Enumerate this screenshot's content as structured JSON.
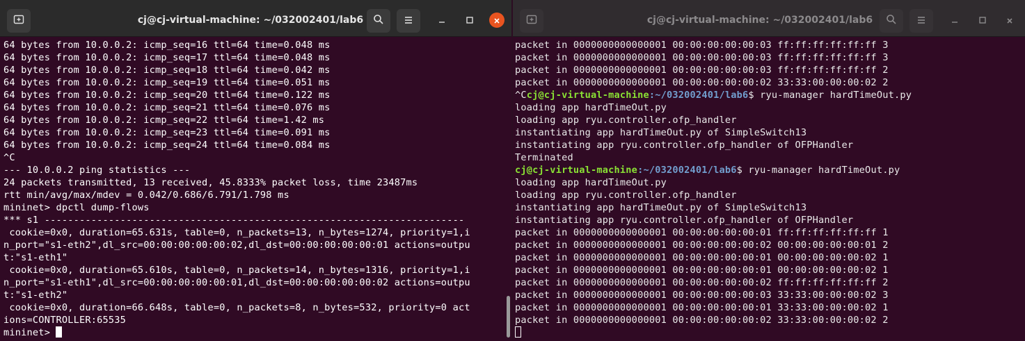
{
  "left_window": {
    "title": "cj@cj-virtual-machine: ~/032002401/lab6",
    "lines": [
      "64 bytes from 10.0.0.2: icmp_seq=16 ttl=64 time=0.048 ms",
      "64 bytes from 10.0.0.2: icmp_seq=17 ttl=64 time=0.048 ms",
      "64 bytes from 10.0.0.2: icmp_seq=18 ttl=64 time=0.042 ms",
      "64 bytes from 10.0.0.2: icmp_seq=19 ttl=64 time=0.051 ms",
      "64 bytes from 10.0.0.2: icmp_seq=20 ttl=64 time=0.122 ms",
      "64 bytes from 10.0.0.2: icmp_seq=21 ttl=64 time=0.076 ms",
      "64 bytes from 10.0.0.2: icmp_seq=22 ttl=64 time=1.42 ms",
      "64 bytes from 10.0.0.2: icmp_seq=23 ttl=64 time=0.091 ms",
      "64 bytes from 10.0.0.2: icmp_seq=24 ttl=64 time=0.084 ms",
      "^C",
      "--- 10.0.0.2 ping statistics ---",
      "24 packets transmitted, 13 received, 45.8333% packet loss, time 23487ms",
      "rtt min/avg/max/mdev = 0.042/0.686/6.791/1.798 ms",
      "mininet> dpctl dump-flows",
      "*** s1 ------------------------------------------------------------------------",
      " cookie=0x0, duration=65.631s, table=0, n_packets=13, n_bytes=1274, priority=1,i",
      "n_port=\"s1-eth2\",dl_src=00:00:00:00:00:02,dl_dst=00:00:00:00:00:01 actions=outpu",
      "t:\"s1-eth1\"",
      " cookie=0x0, duration=65.610s, table=0, n_packets=14, n_bytes=1316, priority=1,i",
      "n_port=\"s1-eth1\",dl_src=00:00:00:00:00:01,dl_dst=00:00:00:00:00:02 actions=outpu",
      "t:\"s1-eth2\"",
      " cookie=0x0, duration=66.648s, table=0, n_packets=8, n_bytes=532, priority=0 act",
      "ions=CONTROLLER:65535"
    ],
    "prompt": "mininet> "
  },
  "right_window": {
    "title": "cj@cj-virtual-machine: ~/032002401/lab6",
    "pre_lines": [
      "packet in 0000000000000001 00:00:00:00:00:03 ff:ff:ff:ff:ff:ff 3",
      "packet in 0000000000000001 00:00:00:00:00:03 ff:ff:ff:ff:ff:ff 3",
      "packet in 0000000000000001 00:00:00:00:00:03 ff:ff:ff:ff:ff:ff 2",
      "packet in 0000000000000001 00:00:00:00:00:02 33:33:00:00:00:02 2"
    ],
    "cmd1": {
      "prefix": "^C",
      "user": "cj@cj-virtual-machine",
      "path": ":~/032002401/lab6",
      "command": "$ ryu-manager hardTimeOut.py"
    },
    "mid_lines": [
      "loading app hardTimeOut.py",
      "loading app ryu.controller.ofp_handler",
      "instantiating app hardTimeOut.py of SimpleSwitch13",
      "instantiating app ryu.controller.ofp_handler of OFPHandler",
      "Terminated"
    ],
    "cmd2": {
      "user": "cj@cj-virtual-machine",
      "path": ":~/032002401/lab6",
      "command": "$ ryu-manager hardTimeOut.py"
    },
    "post_lines": [
      "loading app hardTimeOut.py",
      "loading app ryu.controller.ofp_handler",
      "instantiating app hardTimeOut.py of SimpleSwitch13",
      "instantiating app ryu.controller.ofp_handler of OFPHandler",
      "packet in 0000000000000001 00:00:00:00:00:01 ff:ff:ff:ff:ff:ff 1",
      "packet in 0000000000000001 00:00:00:00:00:02 00:00:00:00:00:01 2",
      "packet in 0000000000000001 00:00:00:00:00:01 00:00:00:00:00:02 1",
      "packet in 0000000000000001 00:00:00:00:00:01 00:00:00:00:00:02 1",
      "packet in 0000000000000001 00:00:00:00:00:02 ff:ff:ff:ff:ff:ff 2",
      "packet in 0000000000000001 00:00:00:00:00:03 33:33:00:00:00:02 3",
      "packet in 0000000000000001 00:00:00:00:00:01 33:33:00:00:00:02 1",
      "packet in 0000000000000001 00:00:00:00:00:02 33:33:00:00:00:02 2"
    ]
  },
  "icons": [
    "new-tab-icon",
    "search-icon",
    "hamburger-menu-icon",
    "minimize-icon",
    "maximize-icon",
    "close-icon"
  ],
  "colors": {
    "terminal_bg": "#300a24",
    "titlebar_active": "#2b2b2b",
    "close_button": "#e95420",
    "prompt_user": "#8ae234",
    "prompt_path": "#729fcf"
  }
}
